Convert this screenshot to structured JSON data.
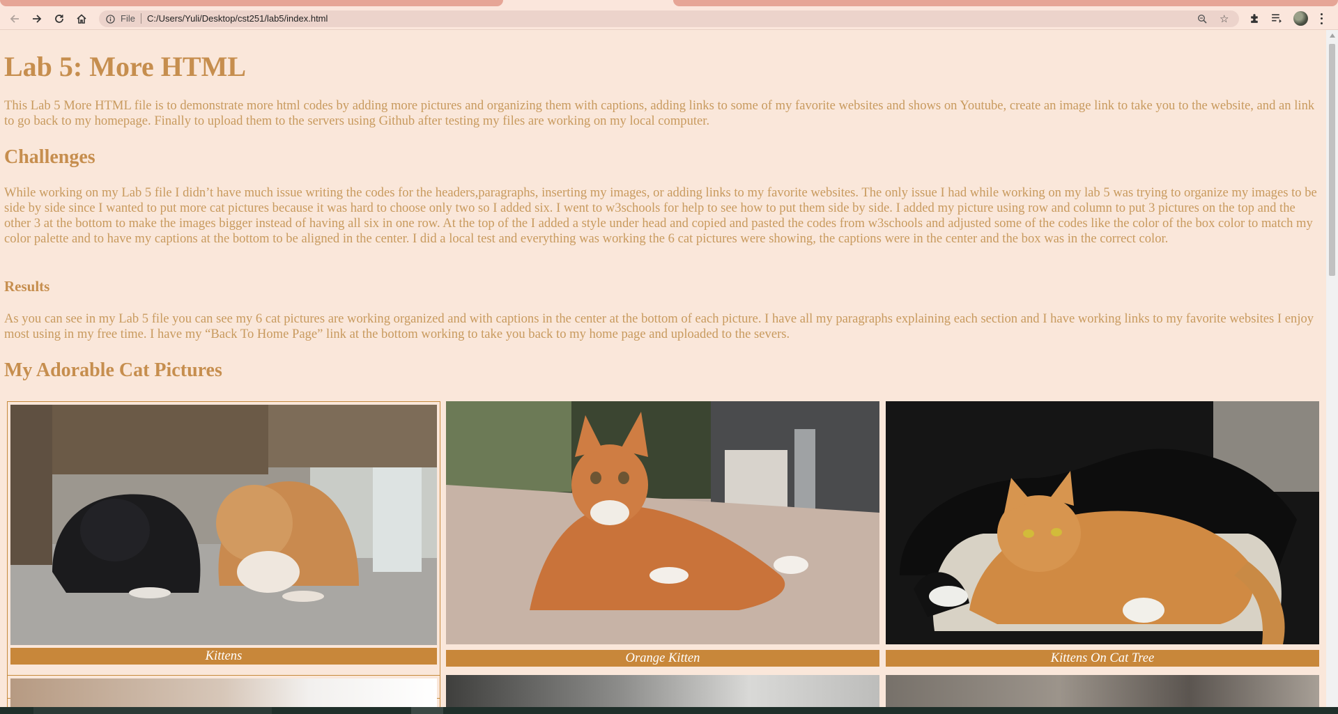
{
  "browser": {
    "scheme_label": "File",
    "url": "C:/Users/Yuli/Desktop/cst251/lab5/index.html",
    "icons": [
      "back-arrow-icon",
      "forward-arrow-icon",
      "reload-icon",
      "home-icon",
      "info-icon",
      "zoom-icon",
      "star-icon",
      "puzzle-extensions-icon",
      "media-queue-icon",
      "profile-avatar",
      "more-menu-icon"
    ]
  },
  "page": {
    "title": "Lab 5: More HTML",
    "intro": "This Lab 5 More HTML file is to demonstrate more html codes by adding more pictures and organizing them with captions, adding links to some of my favorite websites and shows on Youtube, create an image link to take you to the website, and an link to go back to my homepage. Finally to upload them to the servers using Github after testing my files are working on my local computer.",
    "challenges_heading": "Challenges",
    "challenges_text": "While working on my Lab 5 file I didn’t have much issue writing the codes for the headers,paragraphs, inserting my images, or adding links to my favorite websites. The only issue I had while working on my lab 5 was trying to organize my images to be side by side since I wanted to put more cat pictures because it was hard to choose only two so I added six. I went to w3schools for help to see how to put them side by side. I added my picture using row and column to put 3 pictures on the top and the other 3 at the bottom to make the images bigger instead of having all six in one row. At the top of the I added a style under head and copied and pasted the codes from w3schools and adjusted some of the codes like the color of the box color to match my color palette and to have my captions at the bottom to be aligned in the center. I did a local test and everything was working the 6 cat pictures were showing, the captions were in the center and the box was in the correct color.",
    "results_heading": "Results",
    "results_text": "As you can see in my Lab 5 file you can see my 6 cat pictures are working organized and with captions in the center at the bottom of each picture. I have all my paragraphs explaining each section and I have working links to my favorite websites I enjoy most using in my free time. I have my “Back To Home Page” link at the bottom working to take you back to my home page and uploaded to the severs.",
    "gallery_heading": "My Adorable Cat Pictures",
    "gallery": [
      {
        "caption": "Kittens",
        "photo": "black-and-orange-kittens-photo"
      },
      {
        "caption": "Orange Kitten",
        "photo": "orange-kitten-lying-photo"
      },
      {
        "caption": "Kittens On Cat Tree",
        "photo": "kittens-on-cat-tree-photo"
      }
    ]
  },
  "colors": {
    "page_background": "#fae7da",
    "heading": "#c68e4e",
    "text": "#c89a5e",
    "caption_box": "#c8873a"
  }
}
